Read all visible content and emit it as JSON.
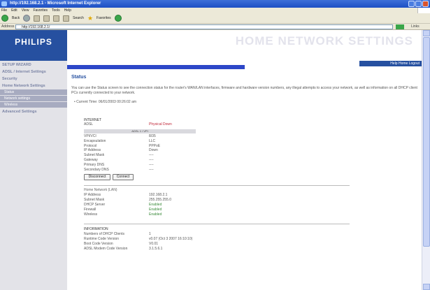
{
  "browser": {
    "title": "http://192.168.2.1 - Microsoft Internet Explorer",
    "menu": [
      "File",
      "Edit",
      "View",
      "Favorites",
      "Tools",
      "Help"
    ],
    "toolbar": {
      "back": "Back",
      "search": "Search",
      "favorites": "Favorites"
    },
    "address": {
      "label": "Address",
      "value": "http://192.168.2.1/",
      "links": "Links"
    }
  },
  "brand": {
    "logo": "PHILIPS",
    "title": "HOME NETWORK SETTINGS",
    "nav": "Help  Home  Logout"
  },
  "sidebar": {
    "items": [
      {
        "label": "SETUP WIZARD"
      },
      {
        "label": "ADSL / Internet Settings"
      },
      {
        "label": "Security"
      },
      {
        "label": "Home Network Settings"
      }
    ],
    "subitems": [
      "Status",
      "Network settings",
      "Wireless"
    ],
    "advanced": "Advanced Settings"
  },
  "main": {
    "title": "Status",
    "description": "You can use the Status screen to see the connection status for the router's WAN/LAN interfaces, firmware and hardware version numbers, any illegal attempts to access your network, as well as information on all DHCP client PCs currently connected to your network.",
    "current_time": "• Current Time: 06/01/2003 00:26:02 am",
    "internet": {
      "heading": "INTERNET",
      "adsl_label": "ADSL",
      "adsl_value": "Physical Down",
      "subheader": "ADSL 1 / VPI",
      "rows": [
        {
          "k": "VPI/VCI",
          "v": "8/35"
        },
        {
          "k": "Encapsulation",
          "v": "LLC"
        },
        {
          "k": "Protocol",
          "v": "PPPoE"
        },
        {
          "k": "IP Address",
          "v": "Down"
        },
        {
          "k": "Subnet Mask",
          "v": "----"
        },
        {
          "k": "Gateway",
          "v": "----"
        },
        {
          "k": "Primary DNS",
          "v": "----"
        },
        {
          "k": "Secondary DNS",
          "v": "----"
        }
      ],
      "disconnect": "Disconnect",
      "connect": "Connect"
    },
    "lan": {
      "heading": "Home Network (LAN)",
      "rows": [
        {
          "k": "IP Address",
          "v": "192.168.2.1"
        },
        {
          "k": "Subnet Mask",
          "v": "255.255.255.0"
        },
        {
          "k": "DHCP Server",
          "v": "Enabled"
        },
        {
          "k": "Firewall",
          "v": "Enabled"
        },
        {
          "k": "Wireless",
          "v": "Enabled"
        }
      ]
    },
    "info": {
      "heading": "INFORMATION",
      "rows": [
        {
          "k": "Numbers of DHCP Clients",
          "v": "1"
        },
        {
          "k": "Runtime Code Version",
          "v": "v0.07 (Oct 3 2007 16:10:10)"
        },
        {
          "k": "Boot Code Version",
          "v": "V0.01"
        },
        {
          "k": "ADSL Modem Code Version",
          "v": "3.1.5.6.1"
        }
      ]
    }
  }
}
